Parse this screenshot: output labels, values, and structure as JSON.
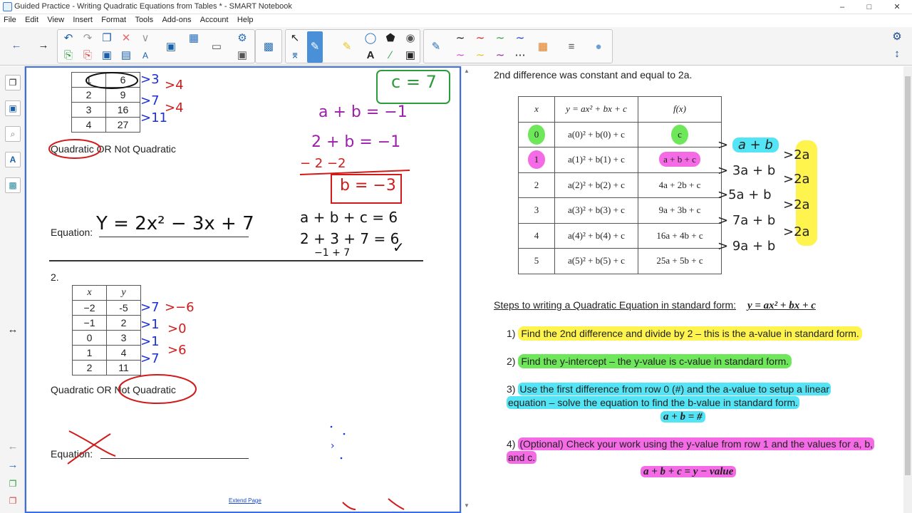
{
  "window": {
    "title": "Guided Practice - Writing Quadratic Equations from Tables * - SMART Notebook",
    "minimize": "–",
    "maximize": "□",
    "close": "✕"
  },
  "menu": [
    "File",
    "Edit",
    "View",
    "Insert",
    "Format",
    "Tools",
    "Add-ons",
    "Account",
    "Help"
  ],
  "colors": {
    "accent": "#3a6ee8",
    "highlight_yellow": "#fff34d",
    "highlight_green": "#6ee85a",
    "highlight_cyan": "#53e5f5",
    "highlight_magenta": "#f56ae5",
    "ink_red": "#d11a1a",
    "ink_blue": "#1a2fd6",
    "ink_purple": "#9b1fa8",
    "ink_green": "#2a9c3a"
  },
  "left_page": {
    "table1": {
      "rows": [
        [
          "1",
          "6"
        ],
        [
          "2",
          "9"
        ],
        [
          "3",
          "16"
        ],
        [
          "4",
          "27"
        ]
      ]
    },
    "choice1": {
      "quadratic": "Quadratic",
      "or": "OR",
      "not": "Not Quadratic"
    },
    "equation_label": "Equation:",
    "problem2_number": "2.",
    "table2": {
      "headers": [
        "x",
        "y"
      ],
      "rows": [
        [
          "−2",
          "-5"
        ],
        [
          "−1",
          "2"
        ],
        [
          "0",
          "3"
        ],
        [
          "1",
          "4"
        ],
        [
          "2",
          "11"
        ]
      ]
    },
    "choice2": {
      "quadratic": "Quadratic",
      "or": "OR",
      "not": "Not Quadratic"
    },
    "equation_label2": "Equation:",
    "extend_page": "Extend Page",
    "handwriting": {
      "c_value": "c = 7",
      "eq1": "a + b = −1",
      "eq2": "2 + b = −1",
      "sub": "− 2        −2",
      "b_value": "b = −3",
      "check1": "a + b + c = 6",
      "check2": "2 + 3 + 7 = 6",
      "check3": "−1 + 7",
      "checkmark": "✓",
      "equation": "Y = 2x² − 3x + 7",
      "diff1_t1": [
        "3",
        "7",
        "11"
      ],
      "diff2_t1": [
        "4",
        "4"
      ],
      "diff1_t2": [
        "7",
        "1",
        "1",
        "7"
      ],
      "diff2_t2": [
        "−6",
        "0",
        "6"
      ]
    }
  },
  "right_page": {
    "heading": "2nd difference was constant and equal to 2a.",
    "table_headers": [
      "x",
      "y = ax² + bx + c",
      "f(x)"
    ],
    "table_rows": [
      [
        "0",
        "a(0)² + b(0) + c",
        "c"
      ],
      [
        "1",
        "a(1)² + b(1) + c",
        "a + b + c"
      ],
      [
        "2",
        "a(2)² + b(2) + c",
        "4a + 2b + c"
      ],
      [
        "3",
        "a(3)² + b(3) + c",
        "9a + 3b + c"
      ],
      [
        "4",
        "a(4)² + b(4) + c",
        "16a + 4b + c"
      ],
      [
        "5",
        "a(5)² + b(5) + c",
        "25a + 5b + c"
      ]
    ],
    "first_diffs": [
      "a + b",
      "3a + b",
      "5a + b",
      "7a + b",
      "9a + b"
    ],
    "second_diffs": [
      "2a",
      "2a",
      "2a",
      "2a"
    ],
    "steps_title": "Steps to writing a Quadratic Equation in standard form:",
    "steps_formula": "y = ax² + bx + c",
    "steps": [
      {
        "num": "1)",
        "text": "Find the 2nd difference and divide by 2 – this is the a-value in standard form."
      },
      {
        "num": "2)",
        "text": "Find the y-intercept – the y-value is c-value in standard form."
      },
      {
        "num": "3)",
        "text": "Use the first difference from row 0 (#) and the a-value to setup a linear equation – solve the equation to find the b-value in standard form.",
        "formula": "a + b = #"
      },
      {
        "num": "4)",
        "text": "(Optional) Check your work using the y-value from row 1 and the values for a, b, and c.",
        "formula": "a + b + c = y − value"
      }
    ]
  }
}
